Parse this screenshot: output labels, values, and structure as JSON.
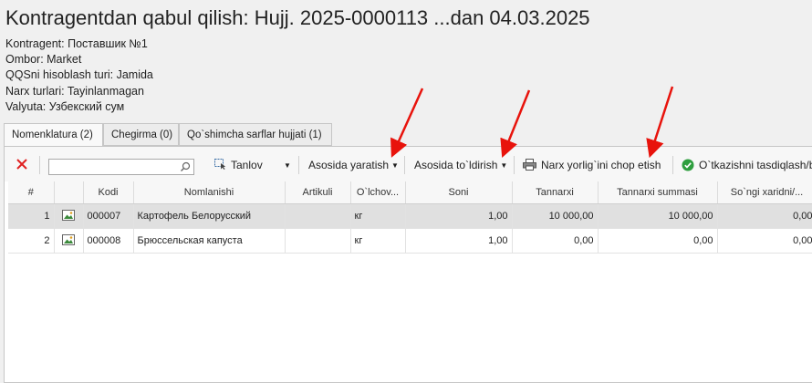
{
  "title": "Kontragentdan qabul qilish: Hujj. 2025-0000113 ...dan 04.03.2025",
  "info": [
    "Kontragent: Поставшик №1",
    "Ombor: Market",
    "QQSni hisoblash turi: Jamida",
    "Narx turlari: Tayinlanmagan",
    "Valyuta: Узбекский сум"
  ],
  "tabs": [
    "Nomenklatura (2)",
    "Chegirma (0)",
    "Qo`shimcha sarflar hujjati (1)"
  ],
  "toolbar": {
    "search_value": "",
    "tanlov": "Tanlov",
    "asosida_yaratish": "Asosida yaratish",
    "asosida_toldirish": "Asosida to`ldirish",
    "narx_yorligi": "Narx yorlig`ini chop etish",
    "otkazish": "O`tkazishni tasdiqlash/b"
  },
  "grid": {
    "headers": [
      "#",
      "",
      "Kodi",
      "Nomlanishi",
      "Artikuli",
      "O`lchov...",
      "Soni",
      "Tannarxi",
      "Tannarxi summasi",
      "So`ngi xaridni/..."
    ],
    "rows": [
      {
        "n": "1",
        "kodi": "000007",
        "name": "Картофель Белорусский",
        "art": "",
        "unit": "кг",
        "soni": "1,00",
        "tannarxi": "10 000,00",
        "summa": "10 000,00",
        "last": "0,00"
      },
      {
        "n": "2",
        "kodi": "000008",
        "name": "Брюссельская капуста",
        "art": "",
        "unit": "кг",
        "soni": "1,00",
        "tannarxi": "0,00",
        "summa": "0,00",
        "last": "0,00"
      }
    ]
  },
  "colors": {
    "annotation_arrow": "#e8130c",
    "delete_icon": "#e02020",
    "confirm_icon": "#2e9e3e"
  }
}
